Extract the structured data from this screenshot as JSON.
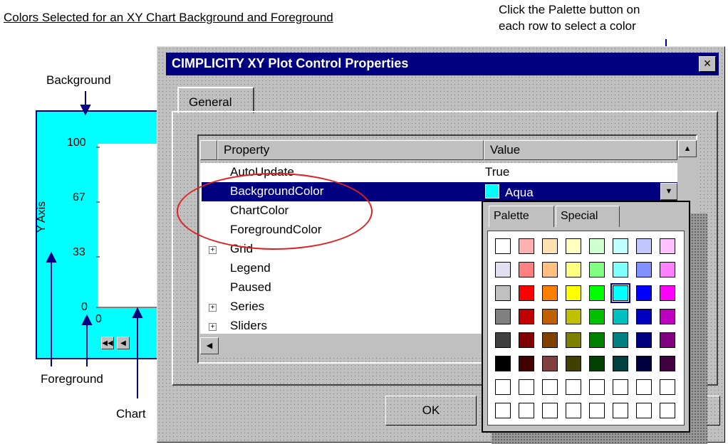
{
  "annotations": {
    "top_left": "Colors Selected for an XY Chart Background and Foreground",
    "top_right_line1": "Click the Palette button on",
    "top_right_line2": "each row to select a color",
    "background_label": "Background",
    "foreground_label": "Foreground",
    "chart_label": "Chart",
    "ellipse_color": "#e02020"
  },
  "sample_chart": {
    "background_color": "#00ffff",
    "y_ticks": [
      "100",
      "67",
      "33",
      "0"
    ],
    "x_tick": "0",
    "y_title": "Y Axis",
    "scroll_icons": [
      "first-page-icon",
      "prev-page-icon"
    ]
  },
  "dialog": {
    "title": "CIMPLICITY XY Plot Control Properties",
    "close_glyph": "×",
    "tab_general": "General",
    "grid": {
      "col_property": "Property",
      "col_value": "Value",
      "rows": [
        {
          "name": "AutoUpdate",
          "value": "True",
          "expand": false
        },
        {
          "name": "BackgroundColor",
          "value": "Aqua",
          "expand": false,
          "selected": true,
          "swatch": "#00ffff"
        },
        {
          "name": "ChartColor",
          "value": "",
          "expand": false
        },
        {
          "name": "ForegroundColor",
          "value": "",
          "expand": false
        },
        {
          "name": "Grid",
          "value": "",
          "expand": true
        },
        {
          "name": "Legend",
          "value": "",
          "expand": false
        },
        {
          "name": "Paused",
          "value": "",
          "expand": false
        },
        {
          "name": "Series",
          "value": "",
          "expand": true
        },
        {
          "name": "Sliders",
          "value": "",
          "expand": true
        }
      ]
    },
    "ok_label": "OK",
    "palette_tab": "Palette",
    "special_tab": "Special",
    "palette_colors": [
      [
        "#ffffff",
        "#ffb0b0",
        "#ffe0b0",
        "#ffffc0",
        "#d0ffd0",
        "#c0ffff",
        "#c0c8ff",
        "#ffc0ff"
      ],
      [
        "#e0e0f0",
        "#ff8080",
        "#ffc080",
        "#ffff80",
        "#80ff80",
        "#80ffff",
        "#8090ff",
        "#ff80ff"
      ],
      [
        "#c0c0c0",
        "#ff0000",
        "#ff8000",
        "#ffff00",
        "#00ff00",
        "#00ffff",
        "#0000ff",
        "#ff00ff"
      ],
      [
        "#808080",
        "#c00000",
        "#c06000",
        "#c0c000",
        "#00c000",
        "#00c0c0",
        "#0000c0",
        "#c000c0"
      ],
      [
        "#404040",
        "#800000",
        "#804000",
        "#808000",
        "#008000",
        "#008080",
        "#000080",
        "#800080"
      ],
      [
        "#000000",
        "#400000",
        "#804040",
        "#404000",
        "#004000",
        "#004040",
        "#000040",
        "#400040"
      ],
      [
        "#ffffff",
        "#ffffff",
        "#ffffff",
        "#ffffff",
        "#ffffff",
        "#ffffff",
        "#ffffff",
        "#ffffff"
      ],
      [
        "#ffffff",
        "#ffffff",
        "#ffffff",
        "#ffffff",
        "#ffffff",
        "#ffffff",
        "#ffffff",
        "#ffffff"
      ]
    ],
    "palette_selected": "#00ffff"
  }
}
